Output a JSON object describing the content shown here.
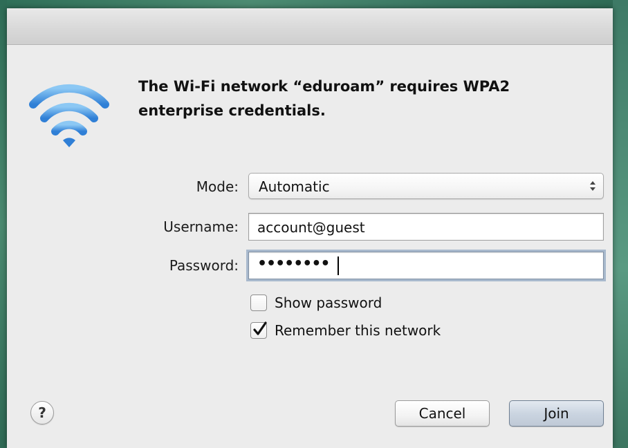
{
  "dialog": {
    "message": "The Wi-Fi network “eduroam” requires WPA2 enterprise credentials.",
    "icon": "wifi-icon",
    "accent_color": "#3b8fe0"
  },
  "form": {
    "mode_label": "Mode:",
    "mode_value": "Automatic",
    "username_label": "Username:",
    "username_value": "account@guest",
    "password_label": "Password:",
    "password_masked": "••••••••",
    "show_password": {
      "label": "Show password",
      "checked": false
    },
    "remember_network": {
      "label": "Remember this network",
      "checked": true
    }
  },
  "buttons": {
    "help_glyph": "?",
    "cancel_label": "Cancel",
    "join_label": "Join"
  }
}
